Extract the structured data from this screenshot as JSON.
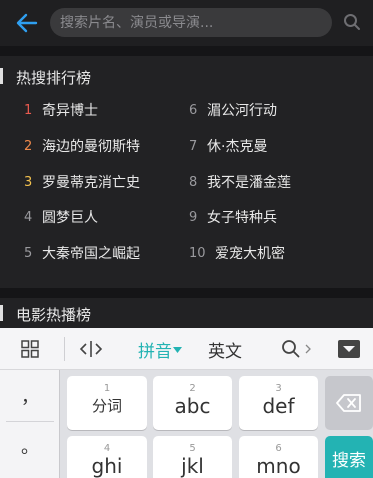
{
  "header": {
    "search_placeholder": "搜索片名、演员或导演..."
  },
  "hot_section": {
    "title": "热搜排行榜",
    "left": [
      {
        "rank": "1",
        "name": "奇异博士",
        "color": "#e85a4f"
      },
      {
        "rank": "2",
        "name": "海边的曼彻斯特",
        "color": "#f08a4b"
      },
      {
        "rank": "3",
        "name": "罗曼蒂克消亡史",
        "color": "#f2c14e"
      },
      {
        "rank": "4",
        "name": "圆梦巨人",
        "color": "#9a9a9e"
      },
      {
        "rank": "5",
        "name": "大秦帝国之崛起",
        "color": "#9a9a9e"
      }
    ],
    "right": [
      {
        "rank": "6",
        "name": "湄公河行动"
      },
      {
        "rank": "7",
        "name": "休·杰克曼"
      },
      {
        "rank": "8",
        "name": "我不是潘金莲"
      },
      {
        "rank": "9",
        "name": "女子特种兵"
      },
      {
        "rank": "10",
        "name": "爱宠大机密"
      }
    ]
  },
  "movie_section": {
    "title": "电影热播榜"
  },
  "keyboard": {
    "toolbar": {
      "pinyin": "拼音",
      "english": "英文"
    },
    "side_keys": [
      "，",
      "。"
    ],
    "keys_row1": [
      {
        "num": "1",
        "label": "分词"
      },
      {
        "num": "2",
        "label": "abc"
      },
      {
        "num": "3",
        "label": "def"
      }
    ],
    "keys_row2": [
      {
        "num": "4",
        "label": "ghi"
      },
      {
        "num": "5",
        "label": "jkl"
      },
      {
        "num": "6",
        "label": "mno"
      }
    ],
    "search_key": "搜索",
    "accent_color": "#23b3b3"
  }
}
